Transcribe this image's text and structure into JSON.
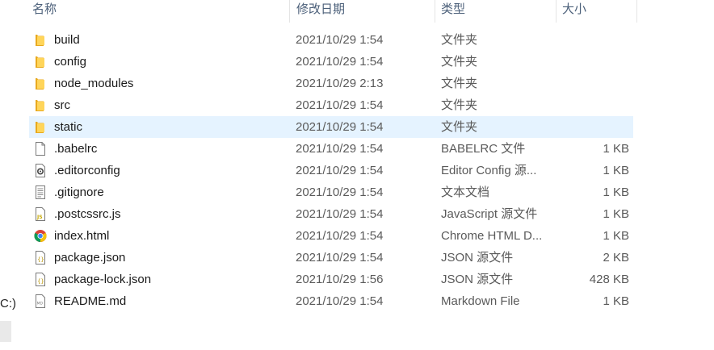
{
  "header": {
    "top_glyph": "\\",
    "columns": {
      "name": "名称",
      "modified": "修改日期",
      "type": "类型",
      "size": "大小"
    }
  },
  "left_pane": {
    "fragment": "C:)"
  },
  "files": [
    {
      "name": "build",
      "modified": "2021/10/29 1:54",
      "type": "文件夹",
      "size": "",
      "icon": "folder-icon"
    },
    {
      "name": "config",
      "modified": "2021/10/29 1:54",
      "type": "文件夹",
      "size": "",
      "icon": "folder-icon"
    },
    {
      "name": "node_modules",
      "modified": "2021/10/29 2:13",
      "type": "文件夹",
      "size": "",
      "icon": "folder-icon"
    },
    {
      "name": "src",
      "modified": "2021/10/29 1:54",
      "type": "文件夹",
      "size": "",
      "icon": "folder-icon"
    },
    {
      "name": "static",
      "modified": "2021/10/29 1:54",
      "type": "文件夹",
      "size": "",
      "icon": "folder-icon",
      "selected": true
    },
    {
      "name": ".babelrc",
      "modified": "2021/10/29 1:54",
      "type": "BABELRC 文件",
      "size": "1 KB",
      "icon": "blank-file-icon"
    },
    {
      "name": ".editorconfig",
      "modified": "2021/10/29 1:54",
      "type": "Editor Config 源...",
      "size": "1 KB",
      "icon": "config-file-icon"
    },
    {
      "name": ".gitignore",
      "modified": "2021/10/29 1:54",
      "type": "文本文档",
      "size": "1 KB",
      "icon": "text-file-icon"
    },
    {
      "name": ".postcssrc.js",
      "modified": "2021/10/29 1:54",
      "type": "JavaScript 源文件",
      "size": "1 KB",
      "icon": "js-file-icon"
    },
    {
      "name": "index.html",
      "modified": "2021/10/29 1:54",
      "type": "Chrome HTML D...",
      "size": "1 KB",
      "icon": "chrome-icon"
    },
    {
      "name": "package.json",
      "modified": "2021/10/29 1:54",
      "type": "JSON 源文件",
      "size": "2 KB",
      "icon": "json-file-icon"
    },
    {
      "name": "package-lock.json",
      "modified": "2021/10/29 1:56",
      "type": "JSON 源文件",
      "size": "428 KB",
      "icon": "json-file-icon"
    },
    {
      "name": "README.md",
      "modified": "2021/10/29 1:54",
      "type": "Markdown File",
      "size": "1 KB",
      "icon": "markdown-file-icon"
    }
  ]
}
